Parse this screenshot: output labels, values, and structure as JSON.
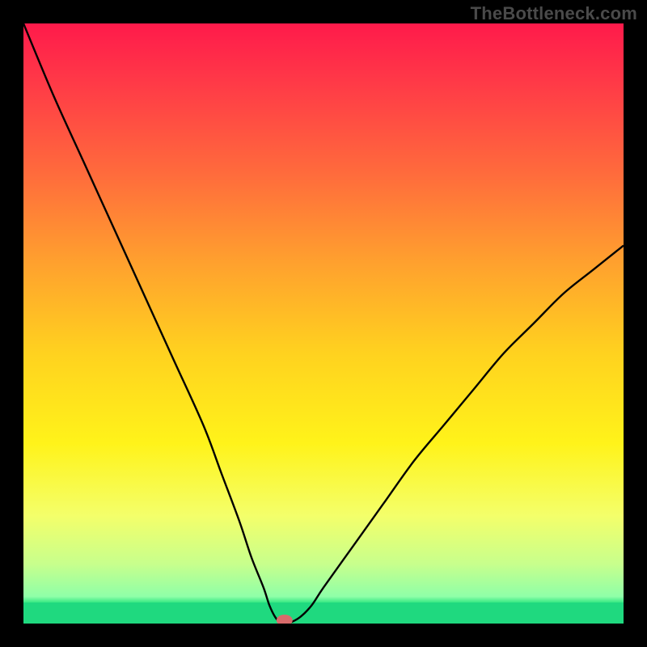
{
  "watermark": "TheBottleneck.com",
  "chart_data": {
    "type": "line",
    "title": "",
    "xlabel": "",
    "ylabel": "",
    "xlim": [
      0,
      100
    ],
    "ylim": [
      0,
      100
    ],
    "x": [
      0,
      5,
      10,
      15,
      20,
      25,
      30,
      33,
      36,
      38,
      40,
      41,
      42,
      43,
      44,
      46,
      48,
      50,
      55,
      60,
      65,
      70,
      75,
      80,
      85,
      90,
      95,
      100
    ],
    "y": [
      100,
      88,
      77,
      66,
      55,
      44,
      33,
      25,
      17,
      11,
      6,
      3,
      1,
      0,
      0,
      1,
      3,
      6,
      13,
      20,
      27,
      33,
      39,
      45,
      50,
      55,
      59,
      63
    ],
    "note": "V-shaped bottleneck curve; minimum at roughly x≈43–44 where y≈0. Left branch is steeper than right branch.",
    "marker": {
      "x": 43.5,
      "y": 0
    },
    "green_band_top_fraction": 0.035,
    "gradient_stops": [
      {
        "offset": 0.0,
        "color": "#ff1a4b"
      },
      {
        "offset": 0.1,
        "color": "#ff3a47"
      },
      {
        "offset": 0.25,
        "color": "#ff6b3c"
      },
      {
        "offset": 0.4,
        "color": "#ffa12e"
      },
      {
        "offset": 0.55,
        "color": "#ffd21f"
      },
      {
        "offset": 0.7,
        "color": "#fff31a"
      },
      {
        "offset": 0.82,
        "color": "#f4ff6a"
      },
      {
        "offset": 0.9,
        "color": "#c8ff8c"
      },
      {
        "offset": 0.955,
        "color": "#8fffa8"
      },
      {
        "offset": 0.965,
        "color": "#36e884"
      },
      {
        "offset": 1.0,
        "color": "#14d477"
      }
    ]
  }
}
